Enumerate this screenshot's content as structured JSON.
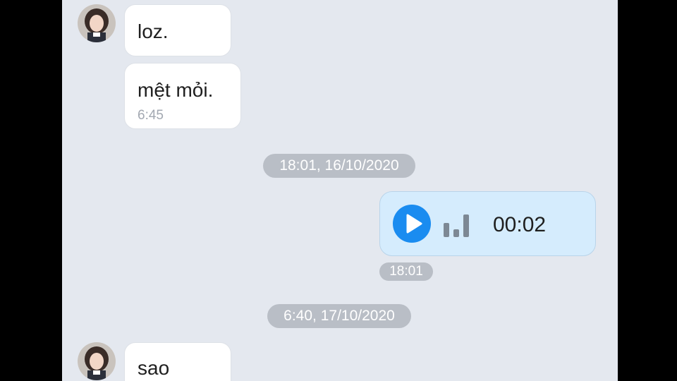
{
  "messages": {
    "m1": {
      "text": "loz."
    },
    "m2": {
      "text": "mệt mỏi.",
      "time": "6:45"
    },
    "date1": "18:01, 16/10/2020",
    "voice": {
      "duration": "00:02",
      "time": "18:01",
      "icon": "play-icon"
    },
    "date2": "6:40, 17/10/2020",
    "m3": {
      "text": "sao"
    }
  },
  "colors": {
    "background": "#e4e8ef",
    "incoming_bubble": "#ffffff",
    "outgoing_bubble": "#d5ecfd",
    "accent": "#1a8cf0",
    "pill": "#b9bec6"
  }
}
